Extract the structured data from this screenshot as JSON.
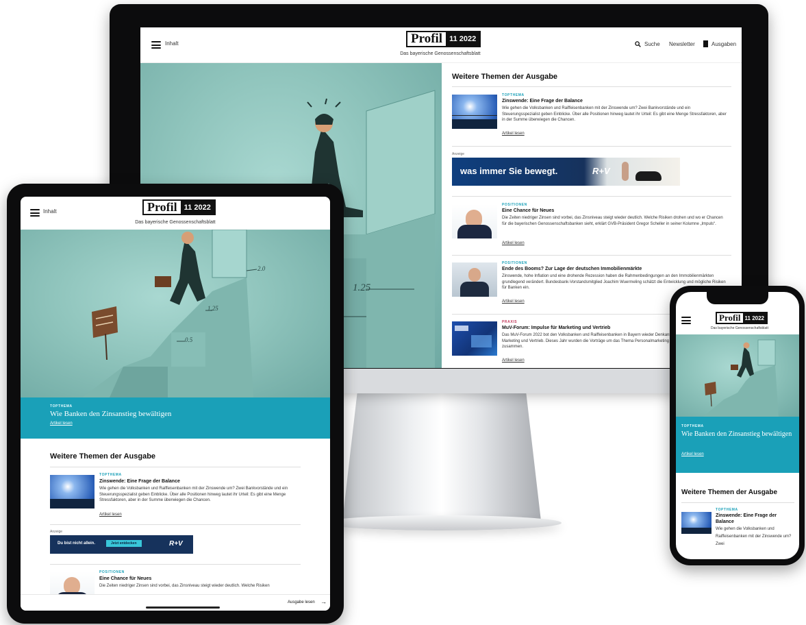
{
  "brand": {
    "logo_word": "Profil",
    "issue": "11 2022",
    "tagline": "Das bayerische Genossenschaftsblatt"
  },
  "desktop": {
    "menu_label": "Inhalt",
    "search_label": "Suche",
    "newsletter_label": "Newsletter",
    "issues_label": "Ausgaben",
    "section_title": "Weitere Themen der Ausgabe",
    "ad_label": "Anzeige",
    "ad_text": "was immer Sie bewegt.",
    "ad_brand": "R+V",
    "articles": [
      {
        "kicker": "Topthema",
        "title": "Zinswende: Eine Frage der Balance",
        "desc": "Wie gehen die Volksbanken und Raiffeisenbanken mit der Zinswende um? Zwei Bankvorstände und ein Steuerungsspezialist geben Einblicke. Über alle Positionen hinweg lautet ihr Urteil: Es gibt eine Menge Stressfaktoren, aber in der Summe überwiegen die Chancen.",
        "link": "Artikel lesen"
      },
      {
        "kicker": "Positionen",
        "title": "Eine Chance für Neues",
        "desc": "Die Zeiten niedriger Zinsen sind vorbei, das Zinsniveau steigt wieder deutlich. Welche Risiken drohen und wo er Chancen für die bayerischen Genossenschaftsbanken sieht, erklärt GVB-Präsident Gregor Scheller in seiner Kolumne „Impuls“.",
        "link": "Artikel lesen"
      },
      {
        "kicker": "Positionen",
        "title": "Ende des Booms? Zur Lage der deutschen Immobilienmärkte",
        "desc": "Zinswende, hohe Inflation und eine drohende Rezession haben die Rahmenbedingungen an den Immobilienmärkten grundlegend verändert. Bundesbank-Vorstandsmitglied Joachim Wuermeling schätzt die Entwicklung und mögliche Risiken für Banken ein.",
        "link": "Artikel lesen"
      },
      {
        "kicker": "Praxis",
        "title": "MuV-Forum: Impulse für Marketing und Vertrieb",
        "desc": "Das MuV-Forum 2022 bot den Volksbanken und Raiffeisenbanken in Bayern wieder Denkanstöße und Praxisbeispiele aus Marketing und Vertrieb. Dieses Jahr wurden die Vorträge um das Thema Personalmarketing ergänzt. „Profil“ fasst zusammen.",
        "link": "Artikel lesen"
      }
    ]
  },
  "hero": {
    "kicker": "Topthema",
    "title": "Wie Banken den Zinsanstieg bewältigen",
    "link": "Artikel lesen",
    "illus_labels": [
      "2.0",
      "1.25",
      "0.5",
      "1.25"
    ]
  },
  "tablet": {
    "menu_label": "Inhalt",
    "section_title": "Weitere Themen der Ausgabe",
    "ad_label": "Anzeige",
    "ad_text": "Du bist nicht allein.",
    "ad_cta": "Jetzt entdecken",
    "ad_brand": "R+V",
    "footer_label": "Ausgabe lesen",
    "articles": [
      {
        "kicker": "Topthema",
        "title": "Zinswende: Eine Frage der Balance",
        "desc": "Wie gehen die Volksbanken und Raiffeisenbanken mit der Zinswende um? Zwei Bankvorstände und ein Steuerungsspezialist geben Einblicke. Über alle Positionen hinweg lautet ihr Urteil: Es gibt eine Menge Stressfaktoren, aber in der Summe überwiegen die Chancen.",
        "link": "Artikel lesen"
      },
      {
        "kicker": "Positionen",
        "title": "Eine Chance für Neues",
        "desc": "Die Zeiten niedriger Zinsen sind vorbei, das Zinsniveau steigt wieder deutlich. Welche Risiken"
      }
    ]
  },
  "phone": {
    "section_title": "Weitere Themen der Ausgabe",
    "article": {
      "kicker": "Topthema",
      "title": "Zinswende: Eine Frage der Balance",
      "desc": "Wie gehen die Volksbanken und Raiffeisenbanken mit der Zinswende um? Zwei"
    }
  },
  "colors": {
    "teal_band": "#1aa0b8",
    "illustration": "#8fc4bc",
    "ad_blue": "#0f3f7f",
    "ad_navy": "#16325c",
    "cta": "#39c6d9"
  }
}
